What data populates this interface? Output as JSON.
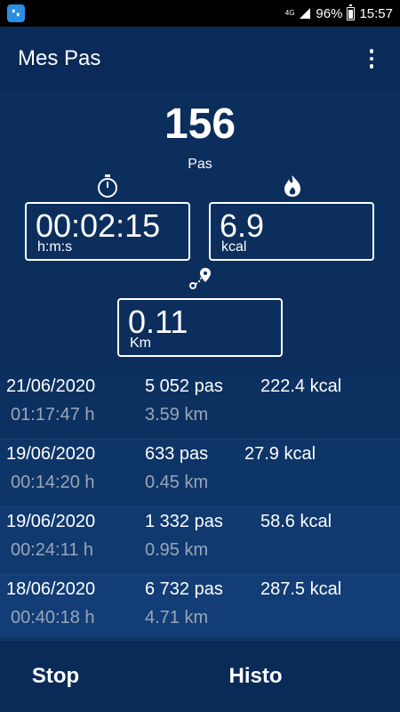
{
  "status_bar": {
    "network": "4G",
    "battery": "96%",
    "time": "15:57",
    "icons": [
      "app-icon",
      "signal-icon",
      "battery-icon"
    ]
  },
  "app_bar": {
    "title": "Mes Pas",
    "menu_icon": "more-vert-icon"
  },
  "steps": {
    "count": "156",
    "label": "Pas"
  },
  "stats": {
    "duration": {
      "value": "00:02:15",
      "unit": "h:m:s",
      "icon": "stopwatch-icon"
    },
    "calories": {
      "value": "6.9",
      "unit": "kcal",
      "icon": "flame-icon"
    },
    "distance": {
      "value": "0.11",
      "unit": "Km",
      "icon": "route-pin-icon"
    }
  },
  "history": [
    {
      "date": "21/06/2020",
      "steps": "5 052 pas",
      "kcal": "222.4 kcal",
      "duration": "01:17:47 h",
      "distance": "3.59 km"
    },
    {
      "date": "19/06/2020",
      "steps": "633 pas",
      "kcal": "27.9 kcal",
      "duration": "00:14:20 h",
      "distance": "0.45 km"
    },
    {
      "date": "19/06/2020",
      "steps": "1 332 pas",
      "kcal": "58.6 kcal",
      "duration": "00:24:11 h",
      "distance": "0.95 km"
    },
    {
      "date": "18/06/2020",
      "steps": "6 732 pas",
      "kcal": "287.5 kcal",
      "duration": "00:40:18 h",
      "distance": "4.71 km"
    }
  ],
  "buttons": {
    "stop": "Stop",
    "histo": "Histo"
  },
  "colors": {
    "background": "#0b2e5d",
    "appbar": "#0a2b59",
    "text": "#ffffff",
    "secondary_text": "#9aa6b8"
  }
}
